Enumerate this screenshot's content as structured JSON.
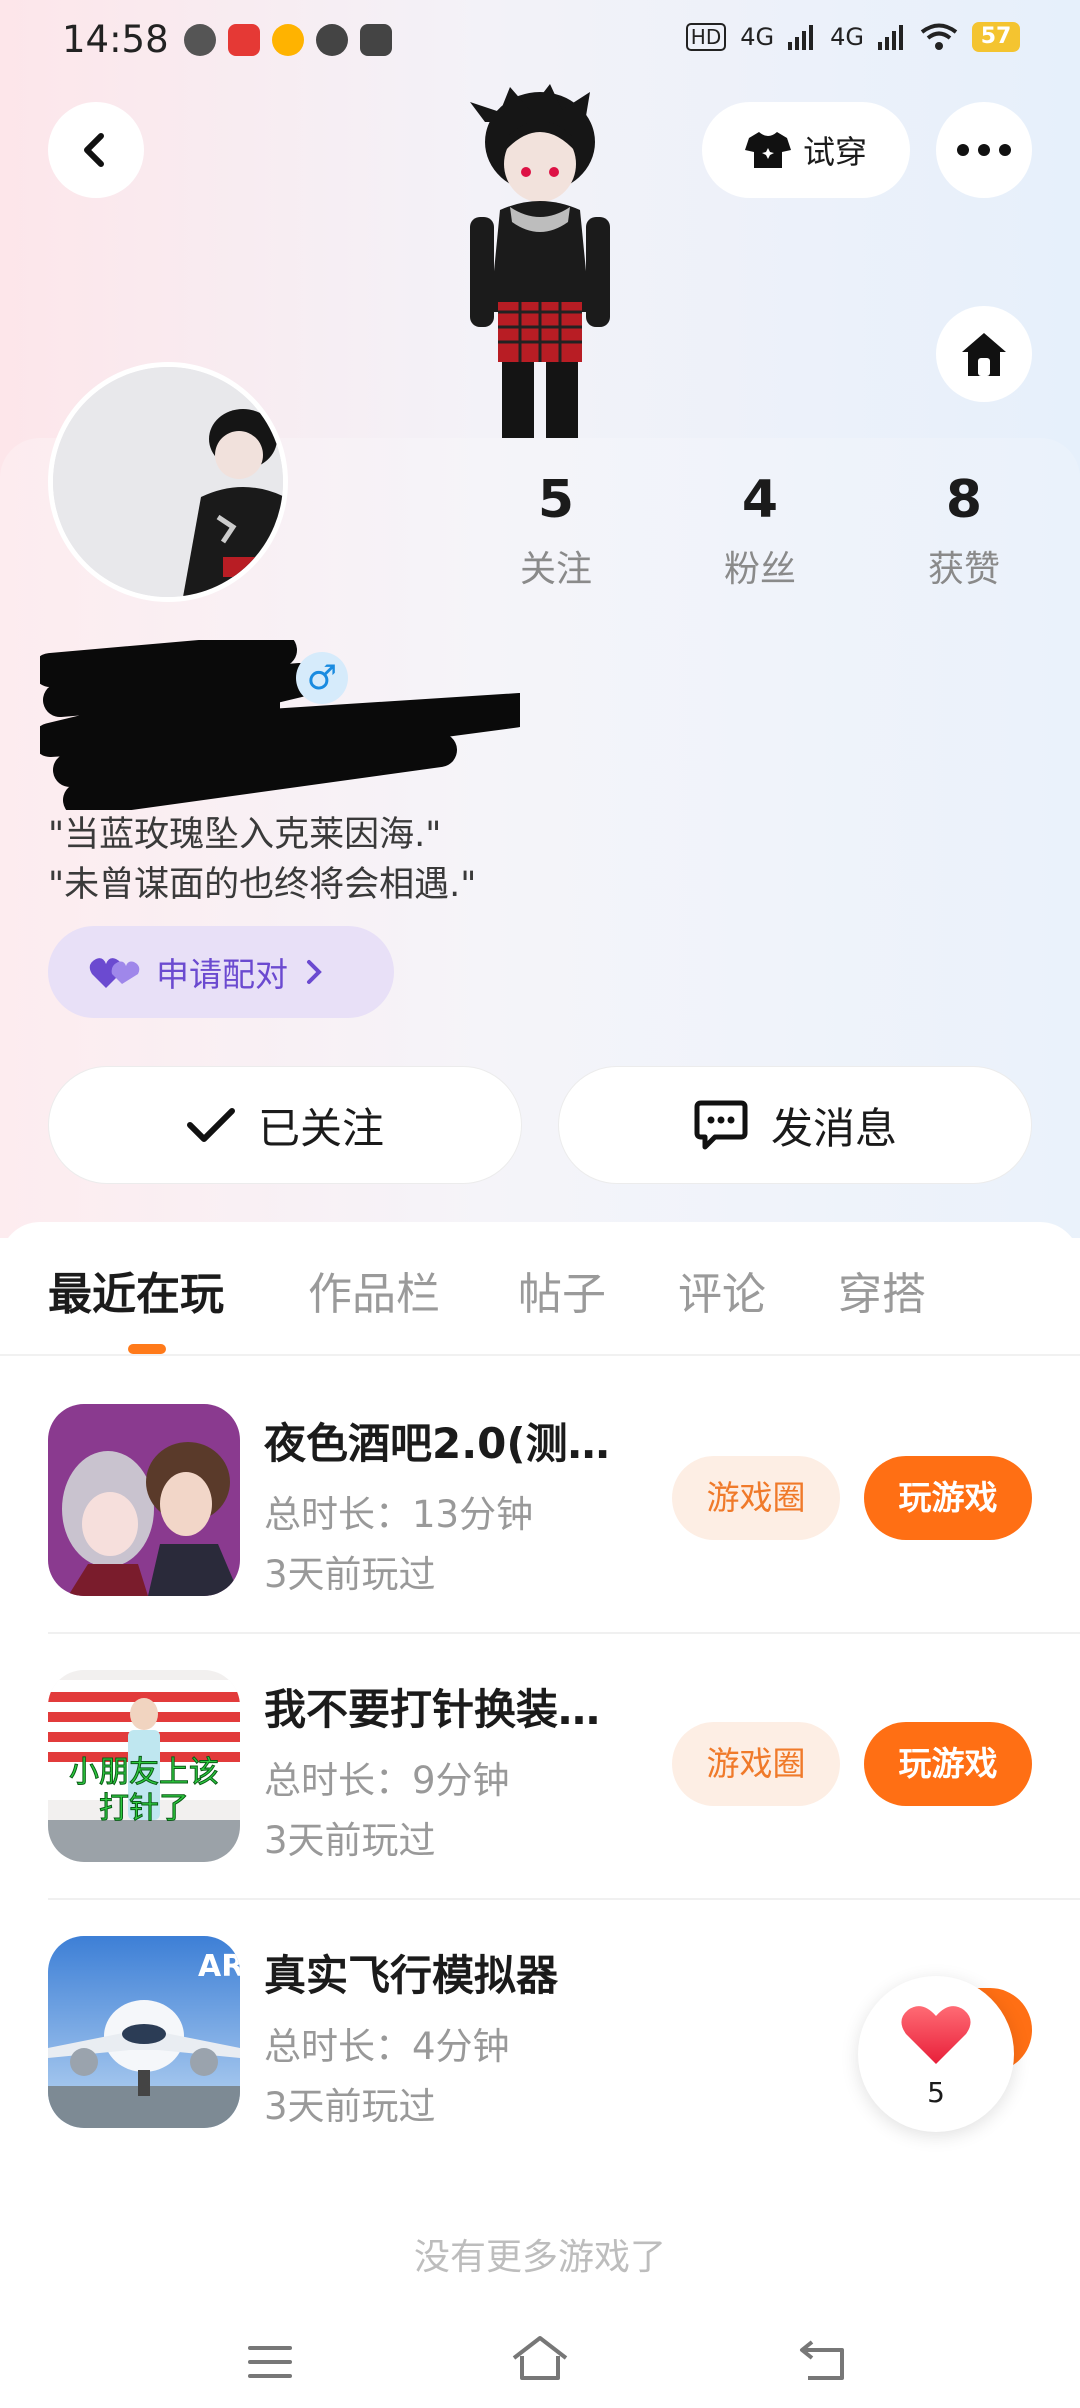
{
  "status_bar": {
    "time": "14:58",
    "network_1": "4G",
    "network_2": "4G",
    "hd": "HD",
    "battery": "57"
  },
  "header": {
    "try_on_label": "试穿"
  },
  "stats": [
    {
      "value": "5",
      "label": "关注"
    },
    {
      "value": "4",
      "label": "粉丝"
    },
    {
      "value": "8",
      "label": "获赞"
    }
  ],
  "profile": {
    "gender_symbol": "♂",
    "bio_line1": "\"当蓝玫瑰坠入克莱因海.\"",
    "bio_line2": "\"未曾谋面的也终将会相遇.\"",
    "match_label": "申请配对"
  },
  "actions": {
    "following_label": "已关注",
    "message_label": "发消息"
  },
  "tabs": [
    "最近在玩",
    "作品栏",
    "帖子",
    "评论",
    "穿搭"
  ],
  "games": [
    {
      "title": "夜色酒吧2.0(测…",
      "duration": "总时长：13分钟",
      "last_played": "3天前玩过",
      "circle_label": "游戏圈",
      "play_label": "玩游戏"
    },
    {
      "title": "我不要打针换装…",
      "duration": "总时长：9分钟",
      "last_played": "3天前玩过",
      "circle_label": "游戏圈",
      "play_label": "玩游戏",
      "thumb_text": "小朋友上该打针了"
    },
    {
      "title": "真实飞行模拟器",
      "duration": "总时长：4分钟",
      "last_played": "3天前玩过",
      "thumb_text": "AR"
    }
  ],
  "like_count": "5",
  "end_text": "没有更多游戏了",
  "colors": {
    "accent_orange": "#ff6f14",
    "match_purple": "#6b4ad0",
    "gender_blue": "#1a8be0"
  }
}
